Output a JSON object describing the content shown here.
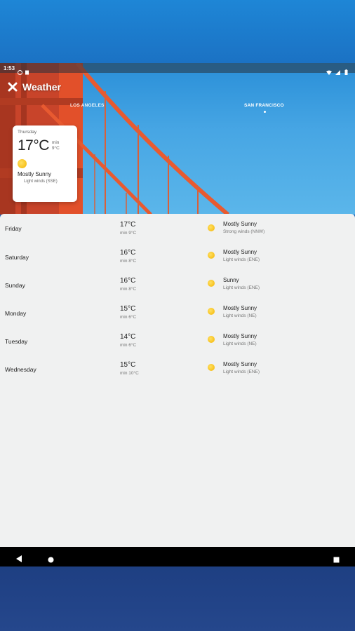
{
  "status_bar": {
    "time": "1:53"
  },
  "app": {
    "title": "Weather"
  },
  "city_tabs": [
    {
      "name": "LOS ANGELES"
    },
    {
      "name": "SAN FRANCISCO",
      "selected": true
    }
  ],
  "today": {
    "day": "Thursday",
    "temp": "17°C",
    "min_label": "min",
    "min_value": "9°C",
    "condition": "Mostly Sunny",
    "wind": "Light winds (SSE)",
    "icon": "sun-icon"
  },
  "forecast": [
    {
      "day": "Friday",
      "temp": "17°C",
      "min": "min 9°C",
      "condition": "Mostly Sunny",
      "wind": "Strong winds (NNW)",
      "icon": "sun-icon"
    },
    {
      "day": "Saturday",
      "temp": "16°C",
      "min": "min 8°C",
      "condition": "Mostly Sunny",
      "wind": "Light winds (ENE)",
      "icon": "sun-icon"
    },
    {
      "day": "Sunday",
      "temp": "16°C",
      "min": "min 8°C",
      "condition": "Sunny",
      "wind": "Light winds (ENE)",
      "icon": "sun-icon"
    },
    {
      "day": "Monday",
      "temp": "15°C",
      "min": "min 6°C",
      "condition": "Mostly Sunny",
      "wind": "Light winds (NE)",
      "icon": "sun-icon"
    },
    {
      "day": "Tuesday",
      "temp": "14°C",
      "min": "min 6°C",
      "condition": "Mostly Sunny",
      "wind": "Light winds (NE)",
      "icon": "sun-icon"
    },
    {
      "day": "Wednesday",
      "temp": "15°C",
      "min": "min 10°C",
      "condition": "Mostly Sunny",
      "wind": "Light winds (ENE)",
      "icon": "sun-icon"
    }
  ],
  "colors": {
    "sun": "#f4b400",
    "bridge": "#e2502a",
    "sky": "#47a6e4",
    "panel": "#f0f1f1"
  }
}
